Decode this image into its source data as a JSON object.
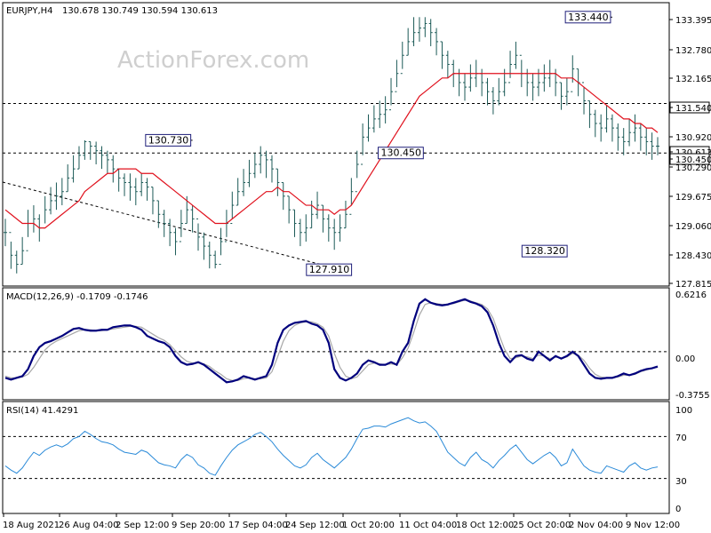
{
  "header": {
    "symbol": "EURJPY,H4",
    "ohlc": "130.678 130.749 130.594 130.613"
  },
  "watermark": "ActionForex.com",
  "colors": {
    "candle": "#1c5a57",
    "ma": "#e0111d",
    "macd": "#00007d",
    "signal": "#a8a8a8",
    "rsi": "#2a8ad8",
    "grid": "#000000"
  },
  "chart_data": [
    {
      "type": "candlestick",
      "panel": "price",
      "title": "EURJPY,H4",
      "ylim": [
        127.6,
        133.7
      ],
      "y_ticks": [
        "133.395",
        "132.780",
        "132.165",
        "131.540",
        "130.920",
        "130.613",
        "130.450",
        "130.290",
        "129.675",
        "129.060",
        "128.430",
        "127.815"
      ],
      "horizontal_levels": [
        131.54,
        130.45
      ],
      "trendline": [
        [
          0,
          129.81
        ],
        [
          58,
          127.92
        ]
      ],
      "data_labels": [
        {
          "text": "133.440",
          "x": 107,
          "y": 133.44
        },
        {
          "text": "130.730",
          "x": 33,
          "y": 130.73
        },
        {
          "text": "130.450",
          "x": 74,
          "y": 130.45
        },
        {
          "text": "128.320",
          "x": 96,
          "y": 128.32
        },
        {
          "text": "127.910",
          "x": 58,
          "y": 127.91
        }
      ],
      "close": [
        128.7,
        128.2,
        128.0,
        128.3,
        128.9,
        129.0,
        128.8,
        129.2,
        129.4,
        129.5,
        129.6,
        129.9,
        130.1,
        130.4,
        130.7,
        130.6,
        130.5,
        130.4,
        130.3,
        130.1,
        129.9,
        129.8,
        129.7,
        129.6,
        129.8,
        129.7,
        129.4,
        129.1,
        128.9,
        128.7,
        128.5,
        128.9,
        129.2,
        129.0,
        128.6,
        128.4,
        128.2,
        128.0,
        128.5,
        128.9,
        129.3,
        129.6,
        129.8,
        130.0,
        130.2,
        130.4,
        130.3,
        130.1,
        129.8,
        129.5,
        129.2,
        128.9,
        128.7,
        128.8,
        129.1,
        129.3,
        129.0,
        128.8,
        128.7,
        128.8,
        129.1,
        129.6,
        130.2,
        130.8,
        131.0,
        131.2,
        131.3,
        131.4,
        131.8,
        132.2,
        132.6,
        132.9,
        133.1,
        133.2,
        133.3,
        133.1,
        132.9,
        132.6,
        132.4,
        132.2,
        132.0,
        131.9,
        132.1,
        132.2,
        132.0,
        131.8,
        131.6,
        131.8,
        132.0,
        132.4,
        132.6,
        132.2,
        132.0,
        131.9,
        132.0,
        132.1,
        132.2,
        132.0,
        131.7,
        131.8,
        132.3,
        132.0,
        131.6,
        131.3,
        131.1,
        131.0,
        131.2,
        131.0,
        130.8,
        130.7,
        130.9,
        131.0,
        130.8,
        130.7,
        130.6,
        130.6
      ],
      "range": [
        [
          128.4,
          129.0
        ],
        [
          127.9,
          128.5
        ],
        [
          127.8,
          128.3
        ],
        [
          128.0,
          128.6
        ],
        [
          128.6,
          129.2
        ],
        [
          128.7,
          129.3
        ],
        [
          128.5,
          129.1
        ],
        [
          128.9,
          129.5
        ],
        [
          129.1,
          129.7
        ],
        [
          129.2,
          129.8
        ],
        [
          129.3,
          129.9
        ],
        [
          129.6,
          130.2
        ],
        [
          129.8,
          130.4
        ],
        [
          130.1,
          130.6
        ],
        [
          130.3,
          130.73
        ],
        [
          130.3,
          130.7
        ],
        [
          130.2,
          130.7
        ],
        [
          130.1,
          130.6
        ],
        [
          130.0,
          130.5
        ],
        [
          129.8,
          130.4
        ],
        [
          129.6,
          130.1
        ],
        [
          129.5,
          130.0
        ],
        [
          129.4,
          130.0
        ],
        [
          129.3,
          129.9
        ],
        [
          129.5,
          130.0
        ],
        [
          129.4,
          129.9
        ],
        [
          129.1,
          129.7
        ],
        [
          128.8,
          129.4
        ],
        [
          128.6,
          129.2
        ],
        [
          128.4,
          129.0
        ],
        [
          128.2,
          128.8
        ],
        [
          128.6,
          129.2
        ],
        [
          128.9,
          129.5
        ],
        [
          128.7,
          129.3
        ],
        [
          128.3,
          128.9
        ],
        [
          128.1,
          128.7
        ],
        [
          127.91,
          128.5
        ],
        [
          127.91,
          128.3
        ],
        [
          128.2,
          128.8
        ],
        [
          128.6,
          129.2
        ],
        [
          129.0,
          129.6
        ],
        [
          129.3,
          129.9
        ],
        [
          129.5,
          130.1
        ],
        [
          129.7,
          130.3
        ],
        [
          129.9,
          130.45
        ],
        [
          130.0,
          130.6
        ],
        [
          129.9,
          130.5
        ],
        [
          129.8,
          130.4
        ],
        [
          129.5,
          130.1
        ],
        [
          129.2,
          129.8
        ],
        [
          128.9,
          129.5
        ],
        [
          128.6,
          129.2
        ],
        [
          128.4,
          129.0
        ],
        [
          128.5,
          129.1
        ],
        [
          128.8,
          129.4
        ],
        [
          129.0,
          129.6
        ],
        [
          128.7,
          129.3
        ],
        [
          128.5,
          129.1
        ],
        [
          128.32,
          129.0
        ],
        [
          128.5,
          129.1
        ],
        [
          128.8,
          129.4
        ],
        [
          129.3,
          129.9
        ],
        [
          129.9,
          130.5
        ],
        [
          130.4,
          131.1
        ],
        [
          130.7,
          131.3
        ],
        [
          130.9,
          131.5
        ],
        [
          131.0,
          131.6
        ],
        [
          131.1,
          131.7
        ],
        [
          131.5,
          132.1
        ],
        [
          131.9,
          132.5
        ],
        [
          132.3,
          132.9
        ],
        [
          132.6,
          133.2
        ],
        [
          132.8,
          133.44
        ],
        [
          132.9,
          133.44
        ],
        [
          133.0,
          133.44
        ],
        [
          132.8,
          133.4
        ],
        [
          132.6,
          133.2
        ],
        [
          132.3,
          132.9
        ],
        [
          132.1,
          132.7
        ],
        [
          131.9,
          132.5
        ],
        [
          131.7,
          132.3
        ],
        [
          131.6,
          132.2
        ],
        [
          131.8,
          132.4
        ],
        [
          131.9,
          132.5
        ],
        [
          131.7,
          132.3
        ],
        [
          131.5,
          132.1
        ],
        [
          131.3,
          131.9
        ],
        [
          131.5,
          132.1
        ],
        [
          131.7,
          132.3
        ],
        [
          132.1,
          132.7
        ],
        [
          132.3,
          132.9
        ],
        [
          131.9,
          132.5
        ],
        [
          131.7,
          132.3
        ],
        [
          131.6,
          132.2
        ],
        [
          131.7,
          132.3
        ],
        [
          131.8,
          132.4
        ],
        [
          131.9,
          132.5
        ],
        [
          131.7,
          132.3
        ],
        [
          131.4,
          132.0
        ],
        [
          131.5,
          132.1
        ],
        [
          132.0,
          132.6
        ],
        [
          131.7,
          132.3
        ],
        [
          131.3,
          131.9
        ],
        [
          131.0,
          131.6
        ],
        [
          130.8,
          131.4
        ],
        [
          130.7,
          131.3
        ],
        [
          130.9,
          131.5
        ],
        [
          130.7,
          131.3
        ],
        [
          130.5,
          131.1
        ],
        [
          130.4,
          131.0
        ],
        [
          130.6,
          131.2
        ],
        [
          130.7,
          131.3
        ],
        [
          130.5,
          131.1
        ],
        [
          130.4,
          131.0
        ],
        [
          130.3,
          130.9
        ],
        [
          130.4,
          130.8
        ]
      ],
      "ma": [
        129.2,
        129.1,
        129.0,
        128.9,
        128.9,
        128.9,
        128.8,
        128.8,
        128.9,
        129.0,
        129.1,
        129.2,
        129.3,
        129.4,
        129.6,
        129.7,
        129.8,
        129.9,
        130.0,
        130.0,
        130.1,
        130.1,
        130.1,
        130.1,
        130.0,
        130.0,
        130.0,
        129.9,
        129.8,
        129.7,
        129.6,
        129.5,
        129.4,
        129.3,
        129.2,
        129.1,
        129.0,
        128.9,
        128.9,
        128.9,
        129.0,
        129.1,
        129.2,
        129.3,
        129.4,
        129.5,
        129.6,
        129.6,
        129.7,
        129.6,
        129.6,
        129.5,
        129.4,
        129.3,
        129.3,
        129.2,
        129.2,
        129.2,
        129.1,
        129.2,
        129.2,
        129.3,
        129.5,
        129.7,
        129.9,
        130.1,
        130.3,
        130.5,
        130.7,
        130.9,
        131.1,
        131.3,
        131.5,
        131.7,
        131.8,
        131.9,
        132.0,
        132.1,
        132.1,
        132.2,
        132.2,
        132.2,
        132.2,
        132.2,
        132.2,
        132.2,
        132.2,
        132.2,
        132.2,
        132.2,
        132.2,
        132.2,
        132.2,
        132.2,
        132.2,
        132.2,
        132.2,
        132.2,
        132.1,
        132.1,
        132.1,
        132.0,
        131.9,
        131.8,
        131.7,
        131.6,
        131.5,
        131.4,
        131.3,
        131.2,
        131.2,
        131.1,
        131.1,
        131.0,
        131.0,
        130.9
      ]
    },
    {
      "type": "line",
      "panel": "macd",
      "title": "MACD(12,26,9) -0.1709 -0.1746",
      "ylim": [
        -0.52,
        0.7
      ],
      "y_ticks": [
        "0.6216",
        "0.00",
        "0.00",
        "-0.3755"
      ],
      "series": [
        {
          "name": "MACD",
          "values": [
            -0.3,
            -0.32,
            -0.3,
            -0.28,
            -0.2,
            -0.05,
            0.05,
            0.1,
            0.12,
            0.15,
            0.18,
            0.22,
            0.26,
            0.27,
            0.25,
            0.24,
            0.24,
            0.25,
            0.25,
            0.28,
            0.29,
            0.3,
            0.3,
            0.28,
            0.25,
            0.18,
            0.15,
            0.12,
            0.1,
            0.05,
            -0.05,
            -0.12,
            -0.15,
            -0.14,
            -0.12,
            -0.15,
            -0.2,
            -0.25,
            -0.3,
            -0.35,
            -0.34,
            -0.32,
            -0.28,
            -0.3,
            -0.32,
            -0.3,
            -0.28,
            -0.15,
            0.1,
            0.25,
            0.3,
            0.33,
            0.34,
            0.35,
            0.32,
            0.3,
            0.25,
            0.1,
            -0.2,
            -0.3,
            -0.33,
            -0.3,
            -0.25,
            -0.15,
            -0.1,
            -0.12,
            -0.15,
            -0.15,
            -0.12,
            -0.15,
            0.0,
            0.1,
            0.35,
            0.55,
            0.6,
            0.56,
            0.54,
            0.53,
            0.54,
            0.56,
            0.58,
            0.6,
            0.57,
            0.55,
            0.52,
            0.45,
            0.3,
            0.1,
            -0.05,
            -0.12,
            -0.05,
            -0.04,
            -0.08,
            -0.1,
            0.0,
            -0.05,
            -0.1,
            -0.05,
            -0.08,
            -0.05,
            0.0,
            -0.05,
            -0.15,
            -0.25,
            -0.3,
            -0.31,
            -0.3,
            -0.3,
            -0.28,
            -0.25,
            -0.27,
            -0.25,
            -0.22,
            -0.2,
            -0.19,
            -0.17
          ]
        },
        {
          "name": "Signal",
          "values": [
            -0.28,
            -0.3,
            -0.3,
            -0.29,
            -0.26,
            -0.18,
            -0.08,
            0.02,
            0.08,
            0.12,
            0.15,
            0.18,
            0.21,
            0.24,
            0.25,
            0.25,
            0.24,
            0.24,
            0.25,
            0.26,
            0.27,
            0.28,
            0.29,
            0.29,
            0.28,
            0.24,
            0.2,
            0.16,
            0.13,
            0.08,
            0.01,
            -0.06,
            -0.11,
            -0.13,
            -0.13,
            -0.14,
            -0.17,
            -0.22,
            -0.26,
            -0.31,
            -0.33,
            -0.33,
            -0.31,
            -0.3,
            -0.31,
            -0.31,
            -0.3,
            -0.23,
            -0.06,
            0.12,
            0.24,
            0.3,
            0.33,
            0.34,
            0.34,
            0.32,
            0.28,
            0.18,
            -0.02,
            -0.18,
            -0.28,
            -0.31,
            -0.29,
            -0.22,
            -0.15,
            -0.13,
            -0.14,
            -0.15,
            -0.14,
            -0.15,
            -0.07,
            0.04,
            0.22,
            0.42,
            0.54,
            0.56,
            0.55,
            0.54,
            0.54,
            0.55,
            0.57,
            0.59,
            0.58,
            0.56,
            0.54,
            0.49,
            0.38,
            0.2,
            0.03,
            -0.08,
            -0.07,
            -0.05,
            -0.06,
            -0.08,
            -0.04,
            -0.05,
            -0.08,
            -0.06,
            -0.07,
            -0.06,
            -0.02,
            -0.04,
            -0.1,
            -0.19,
            -0.26,
            -0.29,
            -0.3,
            -0.3,
            -0.29,
            -0.27,
            -0.27,
            -0.26,
            -0.23,
            -0.21,
            -0.19,
            -0.18
          ]
        }
      ],
      "horizontal_levels": [
        0.0
      ]
    },
    {
      "type": "line",
      "panel": "rsi",
      "title": "RSI(14) 41.4291",
      "ylim": [
        0,
        100
      ],
      "y_ticks": [
        "100",
        "70",
        "30",
        "0"
      ],
      "horizontal_levels": [
        70,
        30
      ],
      "series": [
        {
          "name": "RSI(14)",
          "values": [
            42,
            38,
            35,
            40,
            48,
            55,
            52,
            57,
            60,
            62,
            60,
            63,
            68,
            70,
            75,
            72,
            68,
            65,
            64,
            62,
            58,
            55,
            54,
            53,
            57,
            55,
            50,
            45,
            43,
            42,
            40,
            48,
            53,
            50,
            43,
            40,
            35,
            33,
            42,
            50,
            57,
            62,
            65,
            68,
            72,
            74,
            70,
            65,
            58,
            52,
            47,
            42,
            40,
            43,
            50,
            54,
            48,
            44,
            40,
            45,
            50,
            58,
            68,
            77,
            78,
            80,
            80,
            79,
            82,
            84,
            86,
            88,
            85,
            83,
            84,
            80,
            75,
            65,
            55,
            50,
            45,
            42,
            50,
            55,
            48,
            45,
            40,
            47,
            52,
            58,
            62,
            55,
            48,
            44,
            48,
            52,
            55,
            50,
            42,
            45,
            58,
            50,
            42,
            38,
            36,
            35,
            42,
            40,
            38,
            36,
            42,
            45,
            40,
            38,
            40,
            41
          ]
        }
      ]
    }
  ],
  "x_axis": {
    "tick_labels": [
      "18 Aug 2021",
      "26 Aug 04:00",
      "2 Sep 12:00",
      "9 Sep 20:00",
      "17 Sep 04:00",
      "24 Sep 12:00",
      "1 Oct 20:00",
      "11 Oct 04:00",
      "18 Oct 12:00",
      "25 Oct 20:00",
      "2 Nov 04:00",
      "9 Nov 12:00"
    ]
  }
}
